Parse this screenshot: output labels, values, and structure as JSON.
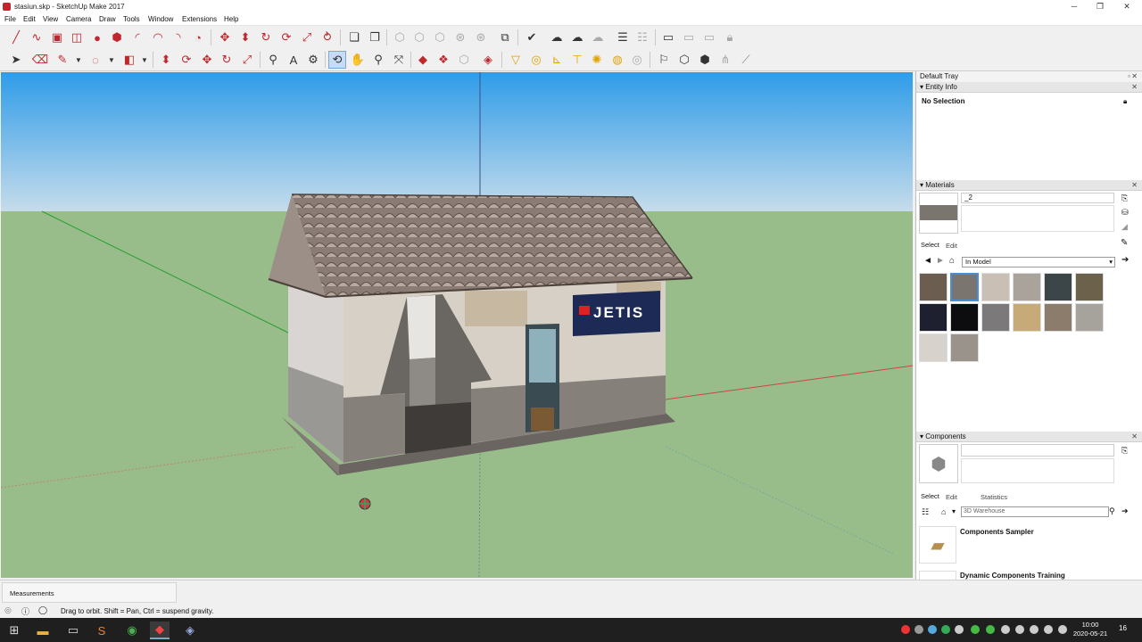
{
  "window": {
    "title": "stasiun.skp - SketchUp Make 2017",
    "controls": [
      "─",
      "❐",
      "✕"
    ]
  },
  "menu": [
    "File",
    "Edit",
    "View",
    "Camera",
    "Draw",
    "Tools",
    "Window",
    "Extensions",
    "Help"
  ],
  "toolbar_icons": {
    "row1": [
      "line-icon",
      "freehand-icon",
      "rectangle-icon",
      "rotated-rect-icon",
      "circle-icon",
      "polygon-icon",
      "arc-icon",
      "arc2-icon",
      "arc3-icon",
      "pie-icon",
      "move-icon",
      "pushpull-icon",
      "rotate-icon",
      "followme-icon",
      "scale-icon",
      "offset-icon",
      "components-icon",
      "group-icon",
      "iso-view-icon",
      "top-view-icon",
      "front-view-icon",
      "right-view-icon",
      "back-view-icon",
      "left-view-icon",
      "bottom-view-icon",
      "xray-icon",
      "wireframe-icon",
      "hidden-line-icon",
      "shaded-icon",
      "textured-icon",
      "monochrome-icon",
      "sandbox-icon",
      "contours-icon",
      "scene-icon",
      "section-icon",
      "section-display-icon",
      "section-cut-icon",
      "lock-icon"
    ],
    "row2": [
      "select-icon",
      "eraser-icon",
      "pencil-icon",
      "paint-icon",
      "material-icon",
      "pushpull2-icon",
      "follow2-icon",
      "move2-icon",
      "rotate2-icon",
      "scale2-icon",
      "tape-icon",
      "text-icon",
      "protractor-icon",
      "orbit-icon",
      "pan-icon",
      "zoom-icon",
      "zoom-extents-icon",
      "warehouse-icon",
      "extension-warehouse-icon",
      "layout-icon",
      "ruby-icon",
      "dimension-icon",
      "circle2-icon",
      "axes-icon",
      "tape2-icon",
      "sun-icon",
      "shadow-icon",
      "walk-icon",
      "lookaround-icon",
      "position-camera-icon",
      "model-info-icon",
      "export-icon",
      "import-icon",
      "sandbox2-icon"
    ]
  },
  "tray": {
    "title": "Default Tray",
    "entity_info": {
      "header": "Entity Info",
      "selection": "No Selection"
    },
    "materials": {
      "header": "Materials",
      "name_value": "_2",
      "tabs": [
        "Select",
        "Edit"
      ],
      "library": "In Model",
      "swatch_colors": [
        "#6b5e50",
        "#7a756e",
        "#c9bfb5",
        "#a9a39b",
        "#3c4648",
        "#6c614a",
        "#1e2030",
        "#0d0d0f",
        "#7b797a",
        "#c6aa78",
        "#8b7c6c",
        "#a6a39c",
        "#d8d2cc",
        "#9a938b"
      ]
    },
    "components": {
      "header": "Components",
      "tabs": [
        "Select",
        "Edit",
        "Statistics"
      ],
      "search_value": "3D Warehouse",
      "items": [
        "Components Sampler",
        "Dynamic Components Training"
      ]
    }
  },
  "measurements": {
    "label": "Measurements",
    "value": ""
  },
  "status": {
    "text": "Drag to orbit. Shift = Pan, Ctrl = suspend gravity."
  },
  "sign": {
    "text": "JETIS"
  },
  "taskbar": {
    "time": "10:00",
    "date": "2020-05-21",
    "notification_count": "16",
    "apps": [
      "windows-start-icon",
      "file-explorer-icon",
      "terminal-icon",
      "sublime-icon",
      "chrome-icon",
      "sketchup-icon",
      "sketchup-layout-icon"
    ]
  }
}
